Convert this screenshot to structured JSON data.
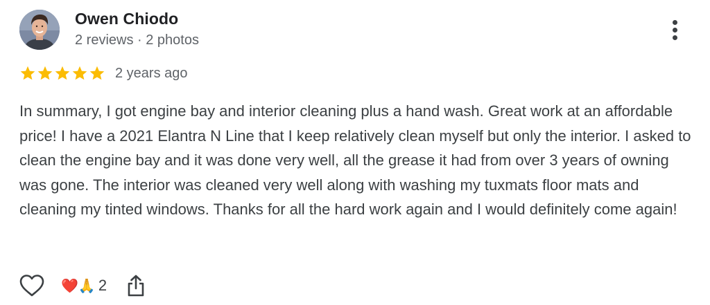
{
  "review": {
    "author": {
      "name": "Owen Chiodo",
      "meta": "2 reviews · 2 photos"
    },
    "rating": 5,
    "rating_max": 5,
    "date": "2 years ago",
    "text": "In summary, I got engine bay and interior cleaning plus a hand wash. Great work at an affordable price! I have a 2021 Elantra N Line that I keep relatively clean myself but only the interior. I asked to clean the engine bay and it was done very well, all the grease it had from over 3 years of owning was gone. The interior was cleaned very well along with washing my tuxmats floor mats and cleaning my tinted windows. Thanks for all the hard work again and I would definitely come again!",
    "reactions": {
      "emojis": "❤️🙏",
      "count": "2"
    }
  },
  "icons": {
    "more": "more-vertical-icon",
    "like": "heart-outline-icon",
    "share": "share-icon",
    "star": "star-icon"
  },
  "colors": {
    "star": "#FBBC04",
    "name": "#202124",
    "meta": "#5f6368",
    "body": "#3c4043"
  }
}
